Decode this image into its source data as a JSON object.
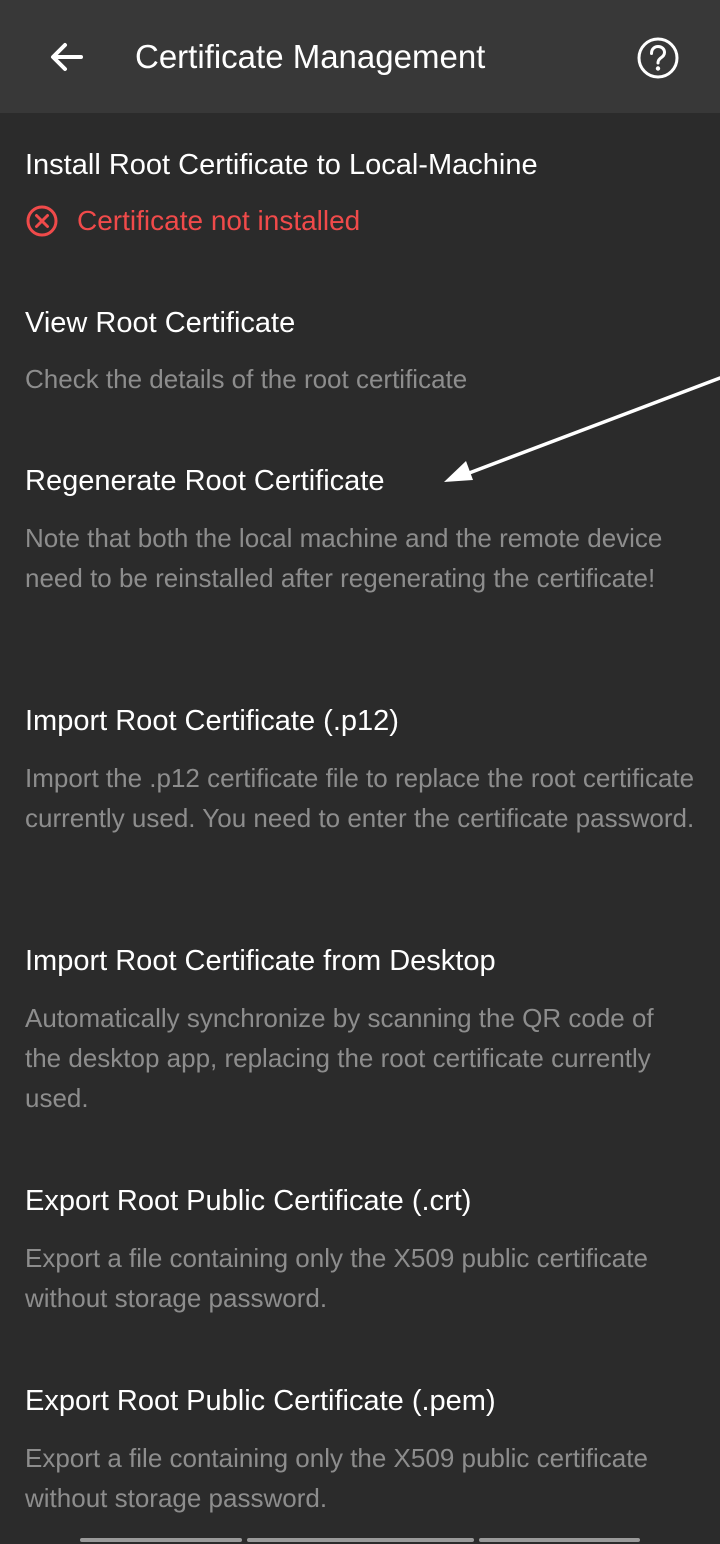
{
  "header": {
    "title": "Certificate Management",
    "back_icon": "arrow-left-icon",
    "help_icon": "help-circle-icon"
  },
  "items": [
    {
      "title": "Install Root Certificate to Local-Machine",
      "status": "Certificate not installed",
      "status_icon": "error-circle-icon",
      "status_color": "#f04a4a"
    },
    {
      "title": "View Root Certificate",
      "subtitle": "Check the details of the root certificate"
    },
    {
      "title": "Regenerate Root Certificate",
      "subtitle": "Note that both the local machine and the remote device need to be reinstalled after regenerating the certificate!"
    },
    {
      "title": "Import Root Certificate (.p12)",
      "subtitle": "Import the .p12 certificate file to replace the root certificate currently used. You need to enter the certificate password."
    },
    {
      "title": "Import Root Certificate from Desktop",
      "subtitle": "Automatically synchronize by scanning the QR code of the desktop app, replacing the root certificate currently used."
    },
    {
      "title": "Export Root Public Certificate (.crt)",
      "subtitle": "Export a file containing only the X509 public certificate without storage password."
    },
    {
      "title": "Export Root Public Certificate (.pem)",
      "subtitle": "Export a file containing only the X509 public certificate without storage password."
    }
  ],
  "colors": {
    "background": "#2b2b2b",
    "app_bar": "#383838",
    "title_text": "#ffffff",
    "subtitle_text": "#8d8d8d",
    "error": "#f04a4a"
  }
}
